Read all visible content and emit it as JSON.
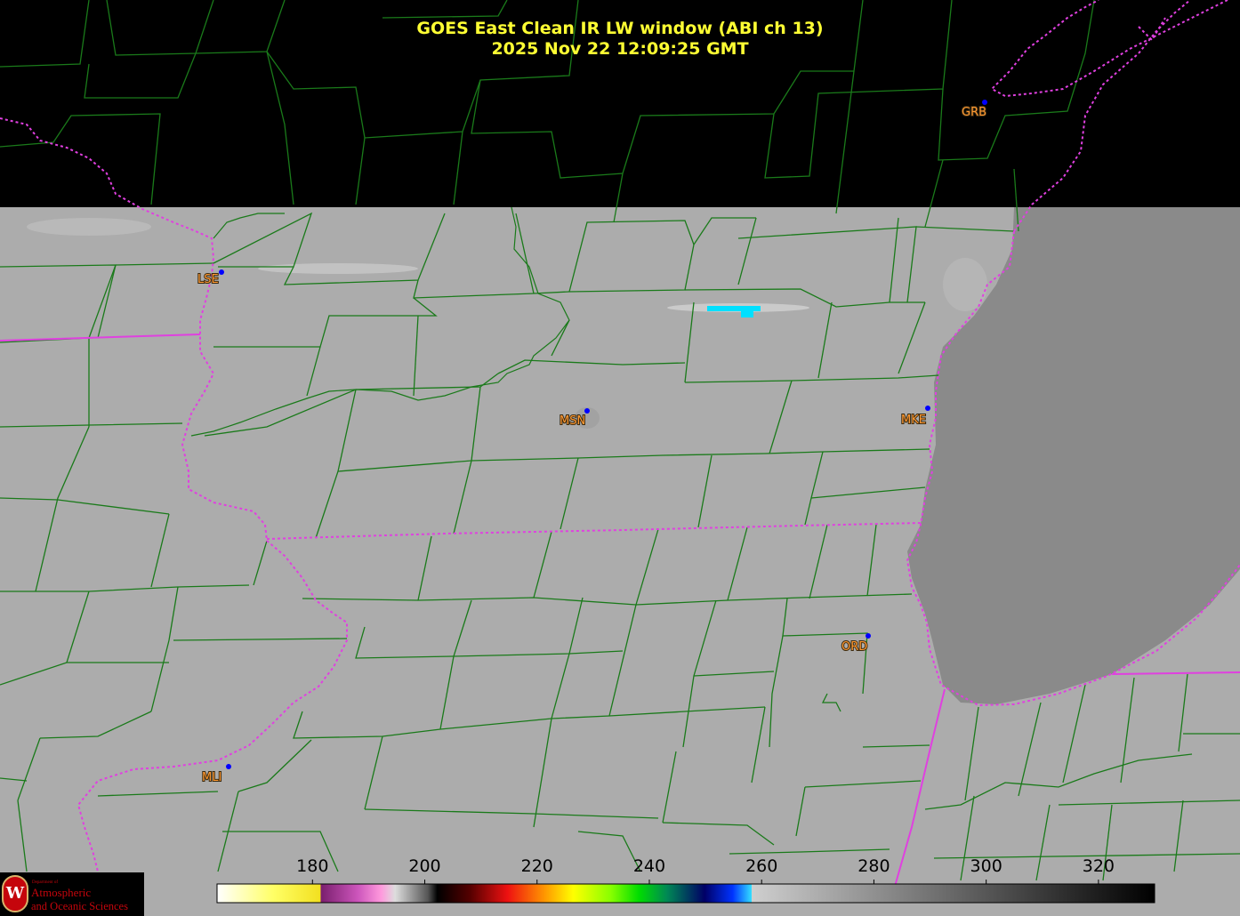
{
  "title": {
    "line1": "GOES East Clean IR LW window (ABI ch 13)",
    "line2": "2025 Nov 22  12:09:25 GMT"
  },
  "stations": [
    {
      "id": "GRB",
      "label": "GRB"
    },
    {
      "id": "LSE",
      "label": "LSE"
    },
    {
      "id": "MSN",
      "label": "MSN"
    },
    {
      "id": "MKE",
      "label": "MKE"
    },
    {
      "id": "ORD",
      "label": "ORD"
    },
    {
      "id": "MLI",
      "label": "MLI"
    }
  ],
  "colorbar": {
    "ticks": [
      "180",
      "200",
      "220",
      "240",
      "260",
      "280",
      "300",
      "320"
    ],
    "range": [
      163,
      330
    ]
  },
  "logo": {
    "seal": "W",
    "dept": "Department of",
    "line1": "Atmospheric",
    "line2": "and Oceanic Sciences"
  },
  "colors": {
    "background": "#000000",
    "land": "#ababab",
    "lake": "#8a8a8a",
    "county_lines": "#1f7a1f",
    "state_borders": "#e040e0",
    "title": "#ffff33",
    "station_labels": "#ff9933",
    "station_dots": "#0000ff",
    "cold_cloud": "#00e0ff"
  }
}
